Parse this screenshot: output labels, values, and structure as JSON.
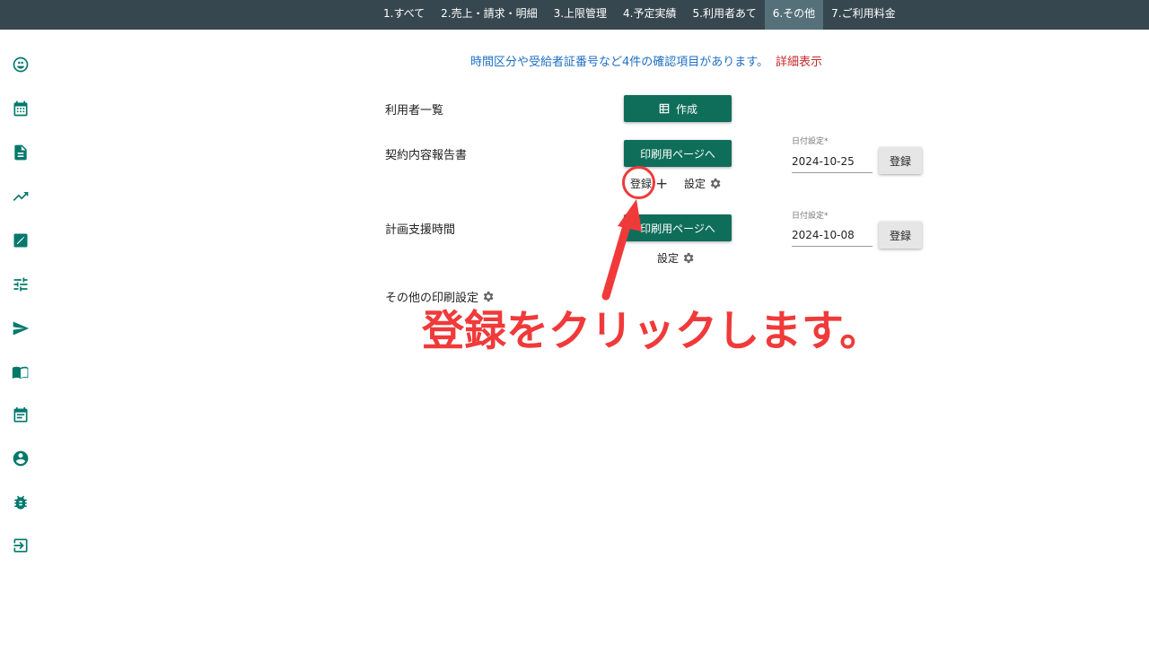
{
  "nav": {
    "tabs": [
      {
        "label": "1.すべて"
      },
      {
        "label": "2.売上・請求・明細"
      },
      {
        "label": "3.上限管理"
      },
      {
        "label": "4.予定実績"
      },
      {
        "label": "5.利用者あて"
      },
      {
        "label": "6.その他",
        "active": true
      },
      {
        "label": "7.ご利用料金"
      }
    ]
  },
  "sidebar": {
    "icons": [
      "face-icon",
      "calendar-icon",
      "document-icon",
      "trending-up-icon",
      "edit-icon",
      "tune-icon",
      "send-icon",
      "book-icon",
      "event-note-icon",
      "account-circle-icon",
      "bug-icon",
      "logout-icon"
    ]
  },
  "notice": {
    "message": "時間区分や受給者証番号など4件の確認項目があります。",
    "link": "詳細表示"
  },
  "rows": {
    "users": {
      "label": "利用者一覧",
      "button": "作成"
    },
    "contract": {
      "label": "契約内容報告書",
      "print_button": "印刷用ページへ",
      "register_link": "登録",
      "plus": "+",
      "settings_link": "設定",
      "date_label": "日付設定*",
      "date_value": "2024-10-25",
      "register_button": "登録"
    },
    "plan": {
      "label": "計画支援時間",
      "print_button": "印刷用ページへ",
      "settings_link": "設定",
      "date_label": "日付設定*",
      "date_value": "2024-10-08",
      "register_button": "登録"
    },
    "other_print": {
      "label": "その他の印刷設定"
    }
  },
  "annotation": {
    "text": "登録をクリックします。",
    "color": "#f03a3a"
  },
  "colors": {
    "topbar": "#37474f",
    "accent_green": "#0f6e5a",
    "sidebar_icon": "#00796b"
  }
}
